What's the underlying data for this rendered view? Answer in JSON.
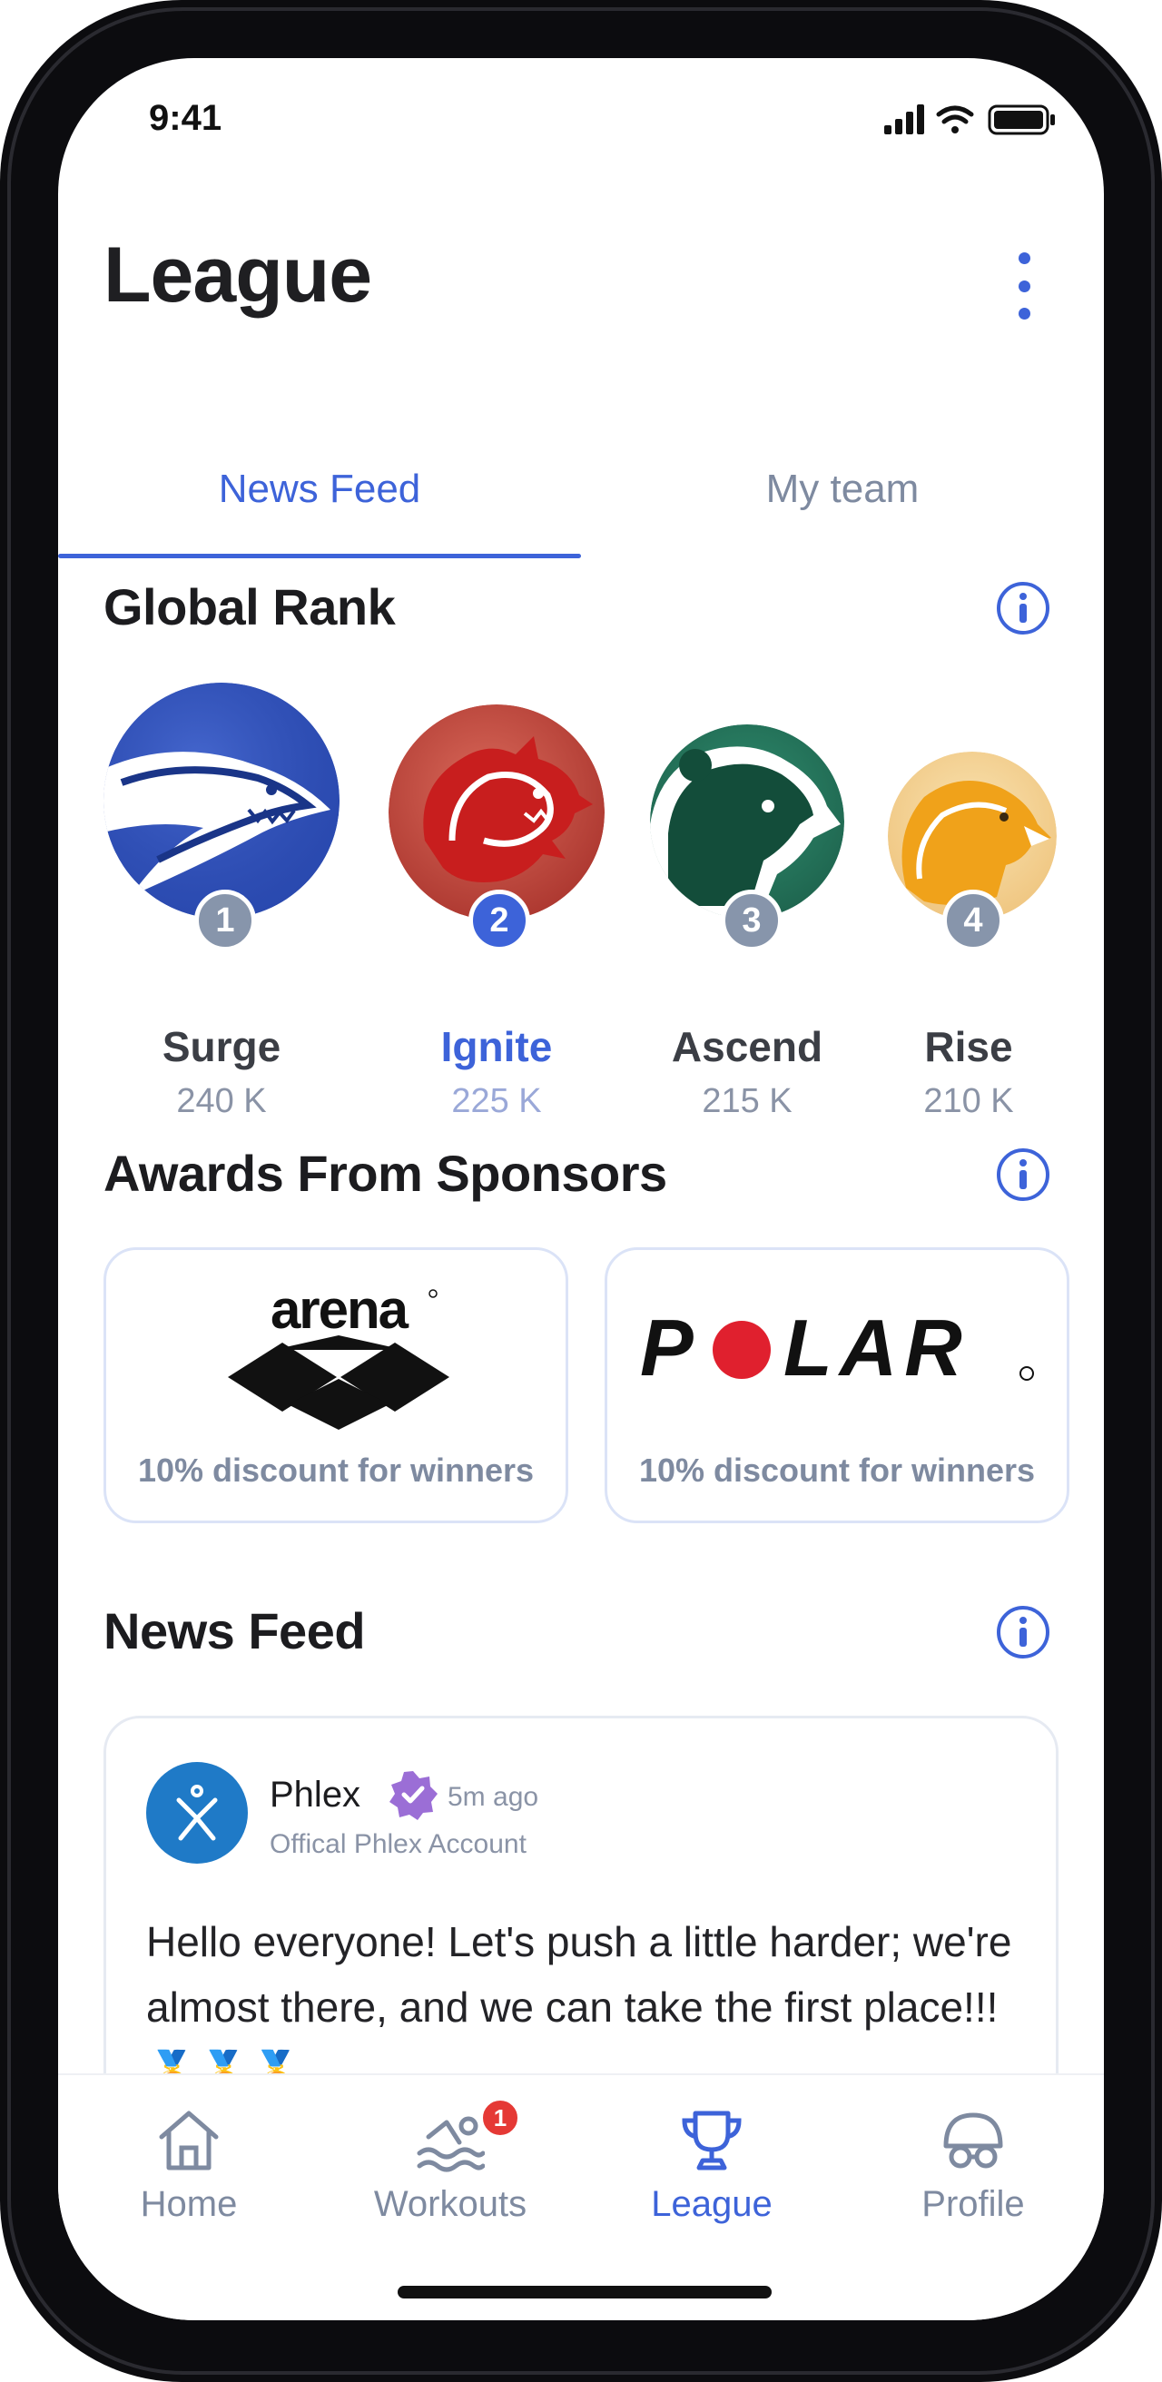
{
  "status": {
    "time": "9:41"
  },
  "header": {
    "title": "League"
  },
  "tabs": [
    {
      "label": "News Feed"
    },
    {
      "label": "My team"
    }
  ],
  "global_rank": {
    "title": "Global Rank",
    "teams": [
      {
        "rank": "1",
        "name": "Surge",
        "score": "240 K"
      },
      {
        "rank": "2",
        "name": "Ignite",
        "score": "225 K"
      },
      {
        "rank": "3",
        "name": "Ascend",
        "score": "215 K"
      },
      {
        "rank": "4",
        "name": "Rise",
        "score": "210 K"
      }
    ]
  },
  "sponsors": {
    "title": "Awards From Sponsors",
    "items": [
      {
        "brand": "arena",
        "caption": "10% discount for winners"
      },
      {
        "brand": "POLAR",
        "caption": "10% discount for winners"
      }
    ]
  },
  "news_feed": {
    "title": "News Feed",
    "post": {
      "author": "Phlex",
      "time": "5m ago",
      "subtitle": "Offical Phlex Account",
      "text": "Hello everyone! Let's push a little harder; we're almost there, and we can take the first place!!! 🥇🥇🥇"
    }
  },
  "bottom_nav": {
    "items": [
      {
        "label": "Home"
      },
      {
        "label": "Workouts",
        "badge": "1"
      },
      {
        "label": "League"
      },
      {
        "label": "Profile"
      }
    ]
  },
  "colors": {
    "accent": "#3d63d9",
    "muted": "#7e8aa0",
    "badge": "#e53935"
  }
}
